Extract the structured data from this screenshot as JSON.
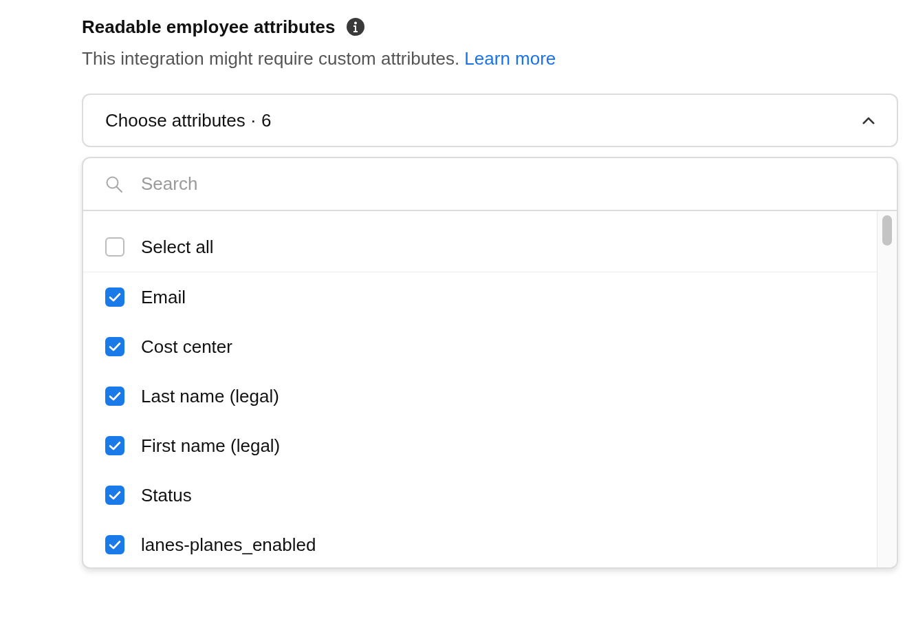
{
  "section": {
    "title": "Readable employee attributes",
    "description": "This integration might require custom attributes.",
    "link": "Learn more"
  },
  "dropdown": {
    "label": "Choose attributes · 6",
    "expanded": true
  },
  "search": {
    "placeholder": "Search"
  },
  "select_all": {
    "label": "Select all",
    "checked": false
  },
  "options": [
    {
      "label": "Email",
      "checked": true
    },
    {
      "label": "Cost center",
      "checked": true
    },
    {
      "label": "Last name (legal)",
      "checked": true
    },
    {
      "label": "First name (legal)",
      "checked": true
    },
    {
      "label": "Status",
      "checked": true
    },
    {
      "label": "lanes-planes_enabled",
      "checked": true
    }
  ]
}
